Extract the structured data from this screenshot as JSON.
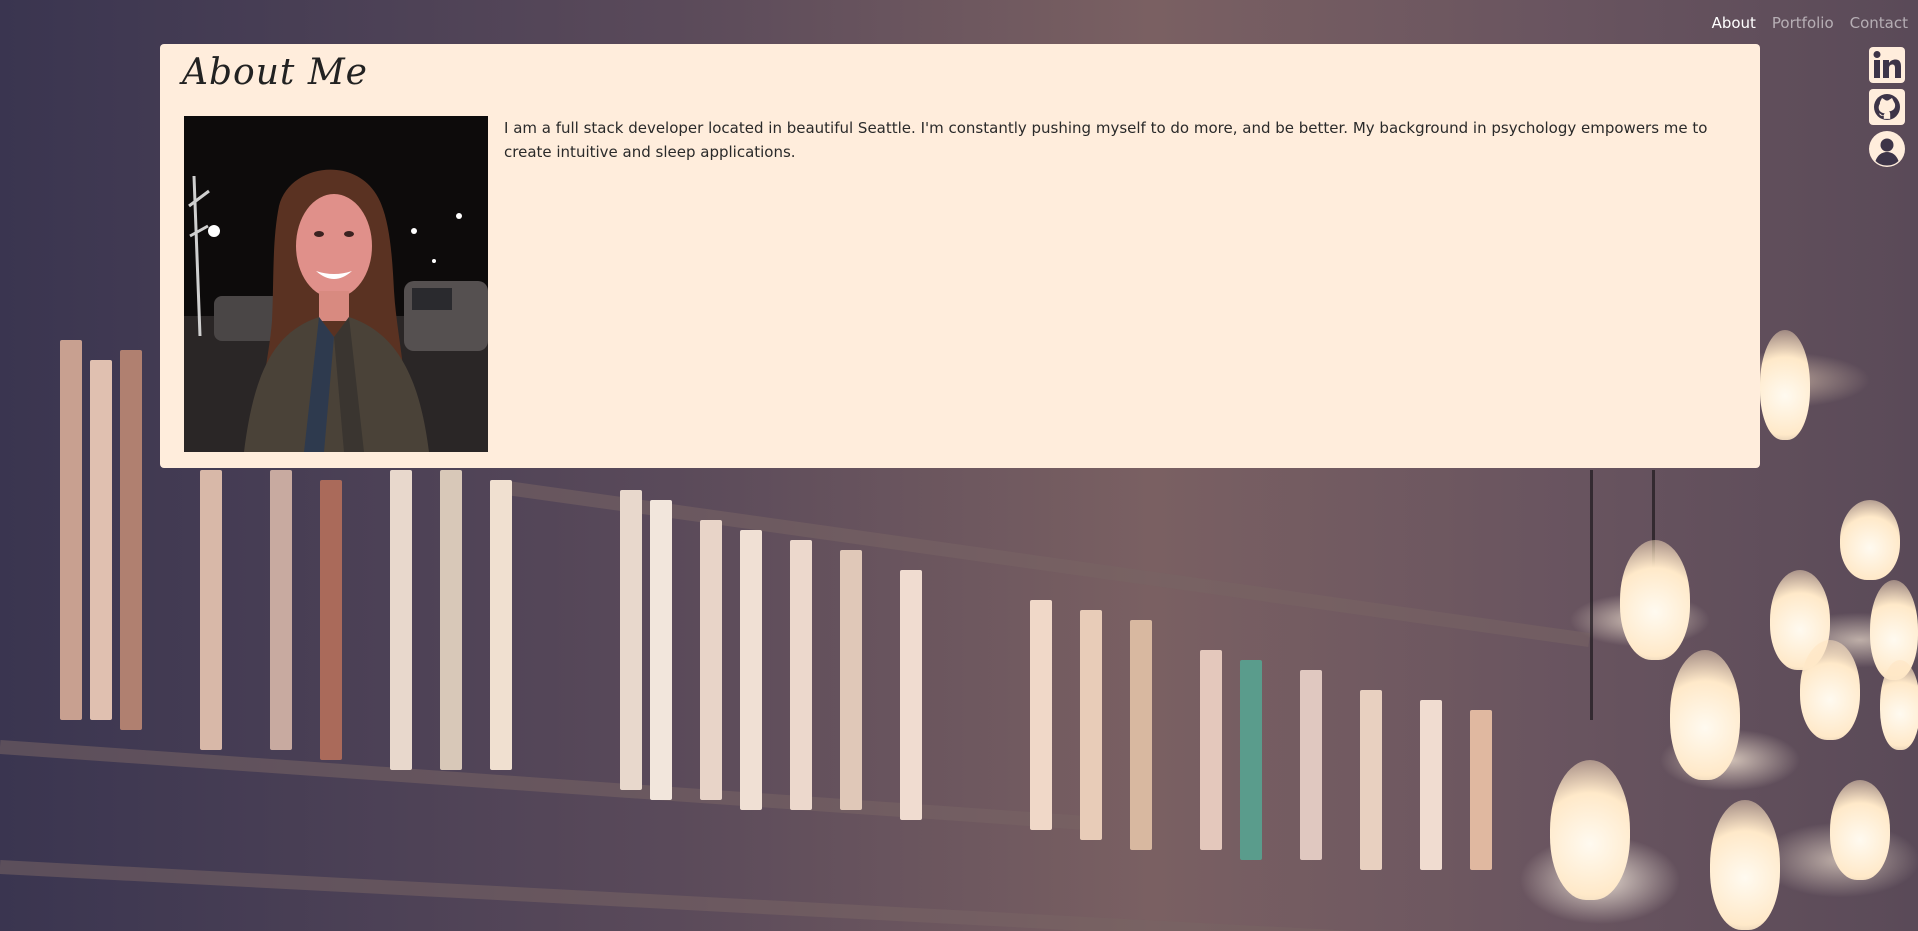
{
  "nav": {
    "items": [
      {
        "label": "About",
        "active": true
      },
      {
        "label": "Portfolio",
        "active": false
      },
      {
        "label": "Contact",
        "active": false
      }
    ]
  },
  "social": {
    "icons": [
      "linkedin-icon",
      "github-icon",
      "user-icon"
    ],
    "color": "#ffeddc"
  },
  "about": {
    "title": "About Me",
    "bio": "I am a full stack developer located in beautiful Seattle. I'm constantly pushing myself to do more, and be better. My background in psychology empowers me to create intuitive and sleep applications."
  },
  "colors": {
    "card_bg": "#ffeddc",
    "nav_active": "#ffffff",
    "nav_inactive": "rgba(255,255,255,0.55)"
  }
}
